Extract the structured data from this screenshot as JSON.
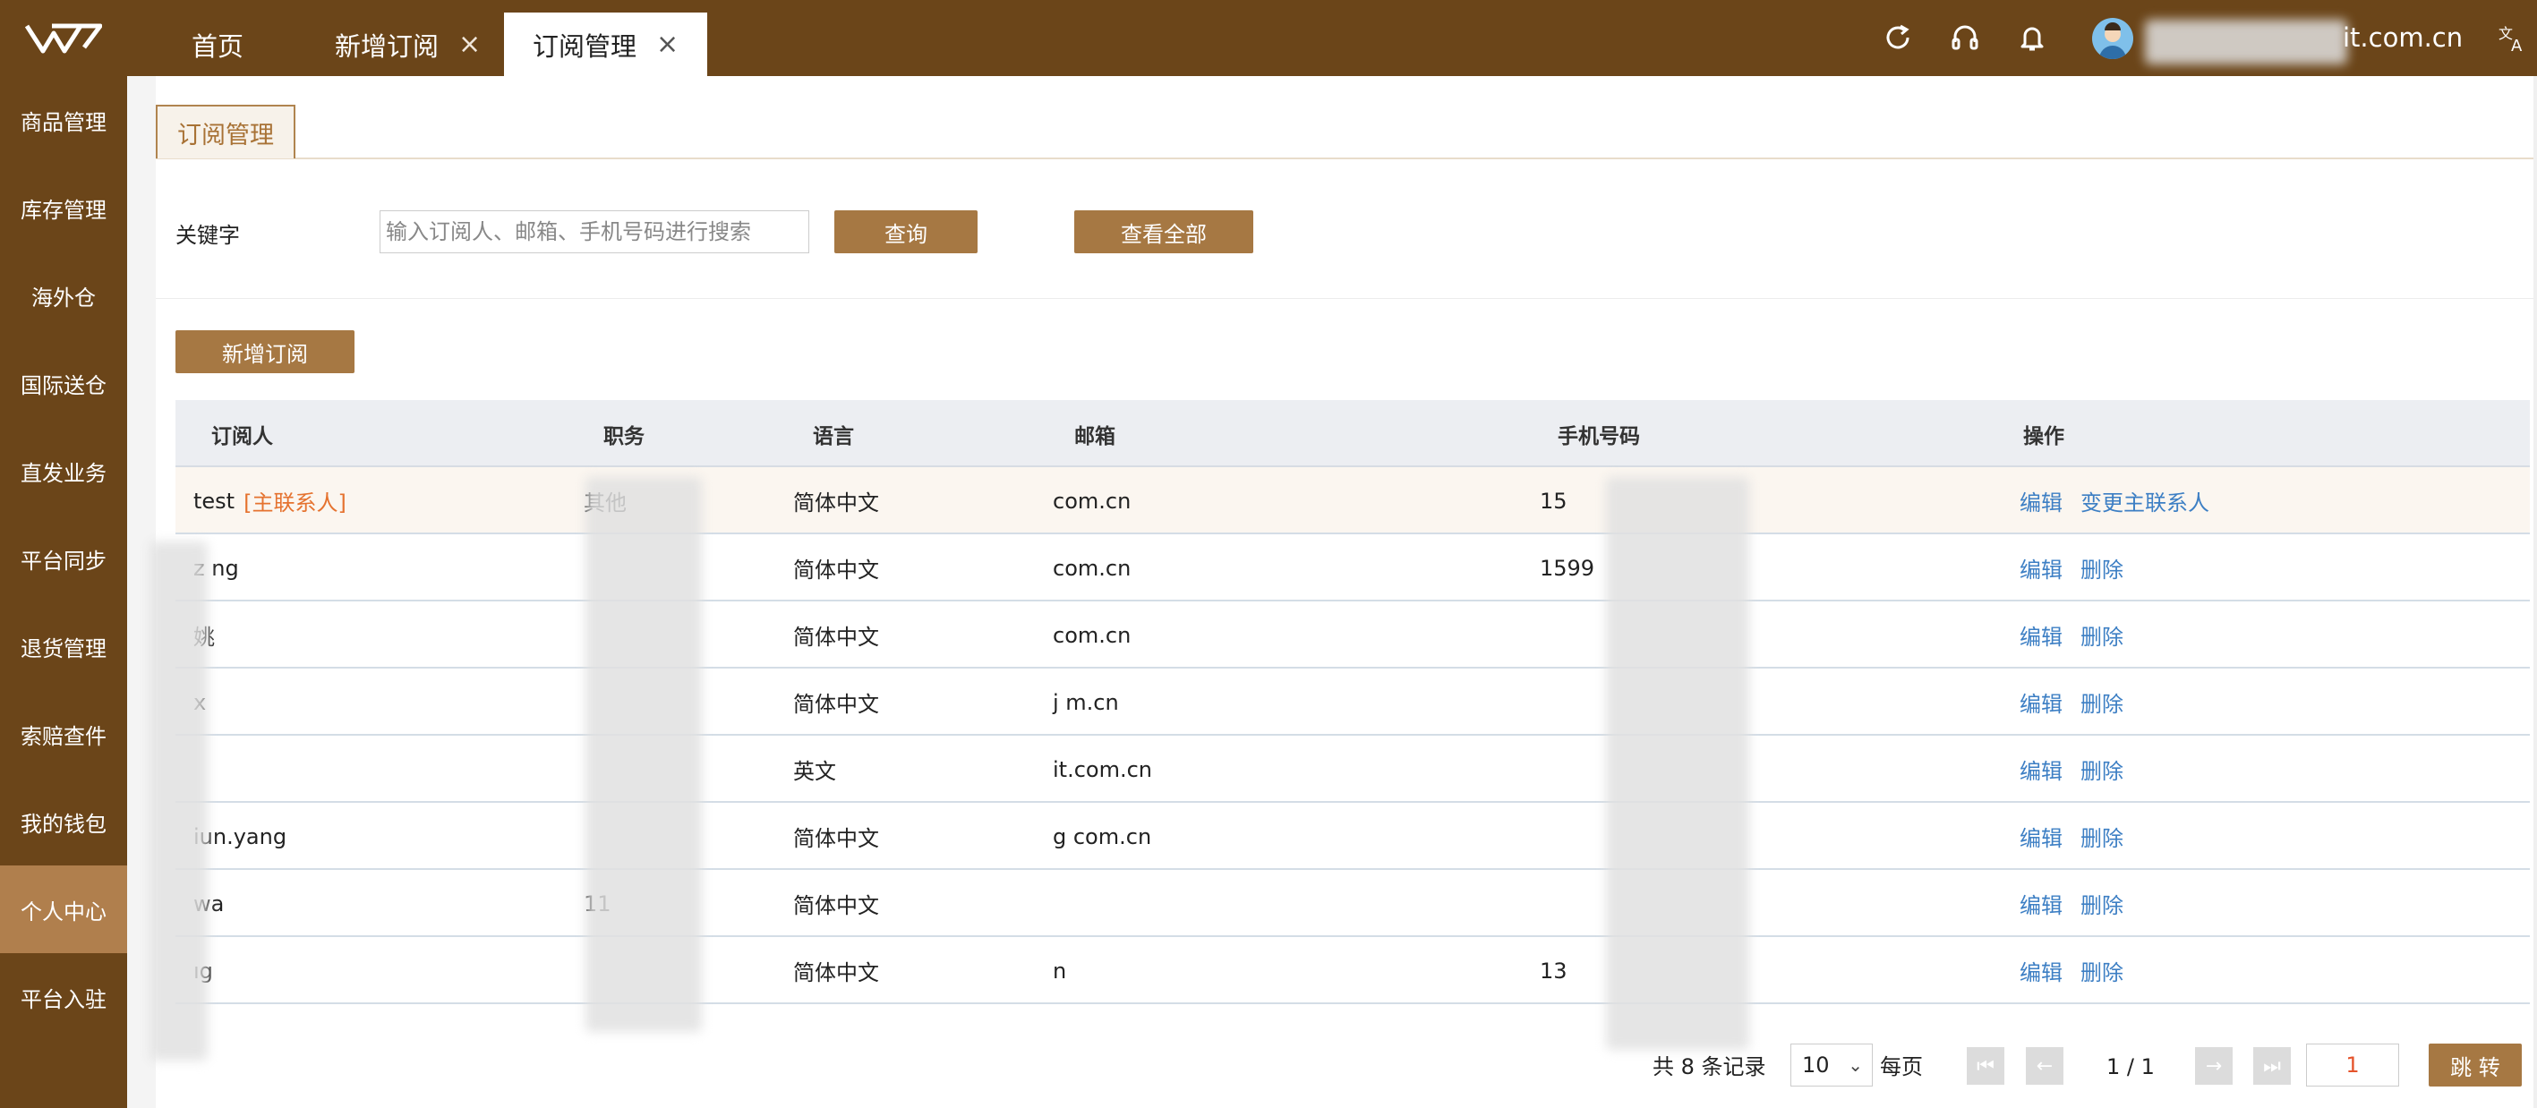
{
  "tabs": [
    {
      "label": "首页"
    },
    {
      "label": "新增订阅"
    },
    {
      "label": "订阅管理"
    }
  ],
  "header": {
    "user_email": "it.com.cn"
  },
  "sidebar": {
    "items": [
      {
        "label": "商品管理"
      },
      {
        "label": "库存管理"
      },
      {
        "label": "海外仓"
      },
      {
        "label": "国际送仓"
      },
      {
        "label": "直发业务"
      },
      {
        "label": "平台同步"
      },
      {
        "label": "退货管理"
      },
      {
        "label": "索赔查件"
      },
      {
        "label": "我的钱包"
      },
      {
        "label": "个人中心"
      },
      {
        "label": "平台入驻"
      }
    ],
    "active_index": 9
  },
  "page": {
    "title": "订阅管理"
  },
  "search": {
    "label": "关键字",
    "placeholder": "输入订阅人、邮箱、手机号码进行搜索",
    "query_label": "查询",
    "view_all_label": "查看全部"
  },
  "toolbar": {
    "add_label": "新增订阅"
  },
  "table": {
    "headers": [
      "订阅人",
      "职务",
      "语言",
      "邮箱",
      "手机号码",
      "操作"
    ],
    "main_contact_tag": "[主联系人]",
    "rows": [
      {
        "name": "test",
        "role": "其他",
        "lang": "简体中文",
        "email": "com.cn",
        "phone": "15",
        "ops": [
          "编辑",
          "变更主联系人"
        ]
      },
      {
        "name": "z        ng",
        "role": "",
        "lang": "简体中文",
        "email": "com.cn",
        "phone": "1599",
        "ops": [
          "编辑",
          "删除"
        ]
      },
      {
        "name": "姚",
        "role": "",
        "lang": "简体中文",
        "email": "com.cn",
        "phone": "",
        "ops": [
          "编辑",
          "删除"
        ]
      },
      {
        "name": "x",
        "role": "",
        "lang": "简体中文",
        "email": "j           m.cn",
        "phone": "",
        "ops": [
          "编辑",
          "删除"
        ]
      },
      {
        "name": "",
        "role": "",
        "lang": "英文",
        "email": "it.com.cn",
        "phone": "",
        "ops": [
          "编辑",
          "删除"
        ]
      },
      {
        "name": "  iun.yang",
        "role": "",
        "lang": "简体中文",
        "email": "        g        com.cn",
        "phone": "",
        "ops": [
          "编辑",
          "删除"
        ]
      },
      {
        "name": "wa",
        "role": "11",
        "lang": "简体中文",
        "email": "",
        "phone": "",
        "ops": [
          "编辑",
          "删除"
        ]
      },
      {
        "name": "  ıg",
        "role": "",
        "lang": "简体中文",
        "email": "n",
        "phone": "13",
        "ops": [
          "编辑",
          "删除"
        ]
      }
    ]
  },
  "pagination": {
    "total_text": "共 8 条记录",
    "page_size": "10",
    "per_page_label": "每页",
    "page_info": "1 / 1",
    "page_input": "1",
    "jump_label": "跳 转"
  },
  "colors": {
    "brand": "#6b4519",
    "accent": "#a67843",
    "link": "#3d7fc4",
    "tag": "#e5722f"
  }
}
